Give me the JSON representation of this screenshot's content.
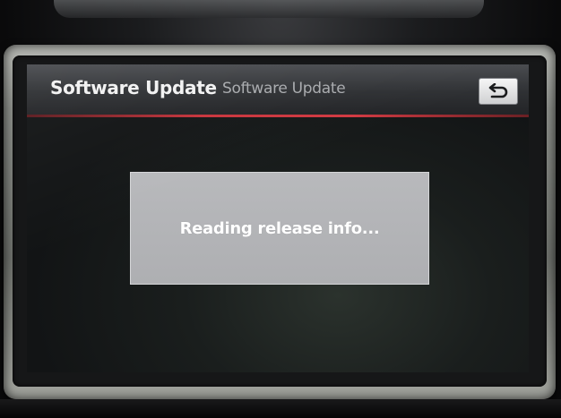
{
  "header": {
    "title": "Software Update",
    "subtitle": "Software Update",
    "back_icon": "return-arrow-icon"
  },
  "dialog": {
    "message": "Reading release info..."
  },
  "colors": {
    "accent_rule": "#c8343c",
    "dialog_bg": "#b3b4b7",
    "header_bg": "#2f3134"
  }
}
